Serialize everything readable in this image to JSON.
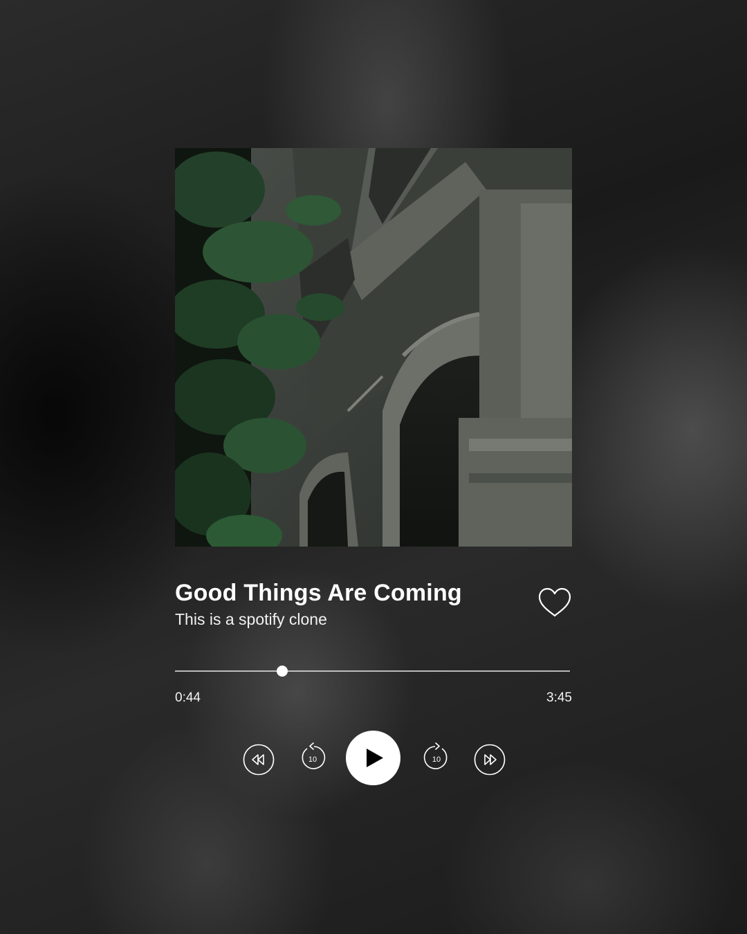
{
  "album_art": {
    "icon": "album-cover-image"
  },
  "track": {
    "title": "Good Things Are Coming",
    "subtitle": "This is a spotify clone",
    "liked_icon": "heart-outline-icon"
  },
  "progress": {
    "current_time": "0:44",
    "total_time": "3:45",
    "fraction": 0.272
  },
  "controls": {
    "rewind_icon": "rewind-icon",
    "skip_back_icon": "skip-back-10-icon",
    "skip_back_label": "10",
    "play_icon": "play-icon",
    "skip_forward_icon": "skip-forward-10-icon",
    "skip_forward_label": "10",
    "fast_forward_icon": "fast-forward-icon"
  },
  "colors": {
    "text": "#ffffff",
    "play_button_bg": "#ffffff",
    "play_glyph": "#000000"
  }
}
